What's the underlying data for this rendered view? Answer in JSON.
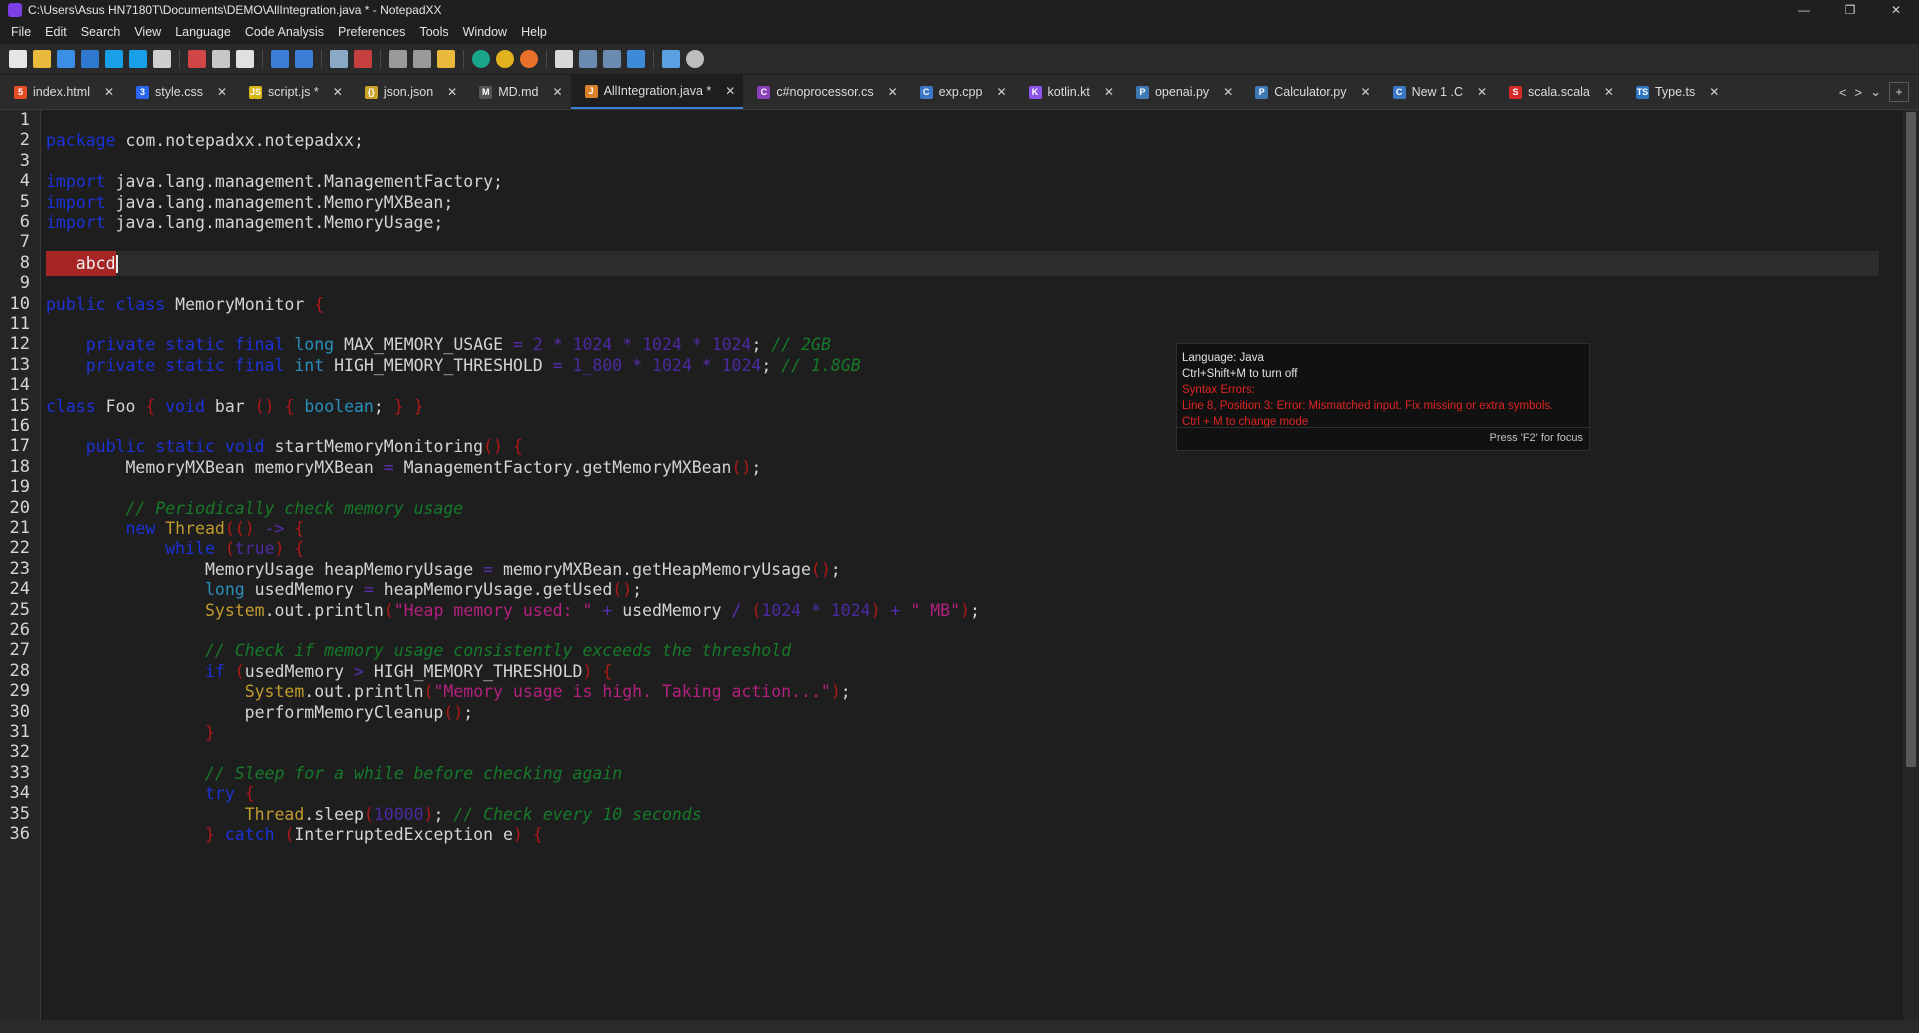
{
  "window": {
    "title": "C:\\Users\\Asus HN7180T\\Documents\\DEMO\\AllIntegration.java * - NotepadXX",
    "controls": {
      "minimize": "—",
      "restore": "❐",
      "close": "✕"
    }
  },
  "menu": [
    "File",
    "Edit",
    "Search",
    "View",
    "Language",
    "Code Analysis",
    "Preferences",
    "Tools",
    "Window",
    "Help"
  ],
  "tabs": [
    {
      "label": "index.html",
      "icon": "html-icon",
      "color": "#e44d26",
      "glyph": "5",
      "close": "✕"
    },
    {
      "label": "style.css",
      "icon": "css-icon",
      "color": "#2965f1",
      "glyph": "3",
      "close": "✕"
    },
    {
      "label": "script.js *",
      "icon": "js-icon",
      "color": "#d6b514",
      "glyph": "JS",
      "close": "✕"
    },
    {
      "label": "json.json",
      "icon": "json-icon",
      "color": "#c9a227",
      "glyph": "{}",
      "close": "✕"
    },
    {
      "label": "MD.md",
      "icon": "markdown-icon",
      "color": "#555555",
      "glyph": "M",
      "close": "✕"
    },
    {
      "label": "AllIntegration.java *",
      "icon": "java-icon",
      "color": "#d9822b",
      "glyph": "J",
      "close": "✕",
      "active": true
    },
    {
      "label": "c#noprocessor.cs",
      "icon": "csharp-icon",
      "color": "#8b3fb8",
      "glyph": "C",
      "close": "✕"
    },
    {
      "label": "exp.cpp",
      "icon": "cpp-icon",
      "color": "#3b77c4",
      "glyph": "C",
      "close": "✕"
    },
    {
      "label": "kotlin.kt",
      "icon": "kotlin-icon",
      "color": "#8c54e8",
      "glyph": "K",
      "close": "✕"
    },
    {
      "label": "openai.py",
      "icon": "python-icon",
      "color": "#3e79b4",
      "glyph": "P",
      "close": "✕"
    },
    {
      "label": "Calculator.py",
      "icon": "python-icon",
      "color": "#3e79b4",
      "glyph": "P",
      "close": "✕"
    },
    {
      "label": "New 1 .C",
      "icon": "c-icon",
      "color": "#3b77c4",
      "glyph": "C",
      "close": "✕"
    },
    {
      "label": "scala.scala",
      "icon": "scala-icon",
      "color": "#d42a2a",
      "glyph": "S",
      "close": "✕"
    },
    {
      "label": "Type.ts",
      "icon": "typescript-icon",
      "color": "#2f74c0",
      "glyph": "TS",
      "close": "✕"
    }
  ],
  "tab_nav": {
    "prev": "<",
    "next": ">",
    "dropdown": "⌄",
    "add": "+"
  },
  "popup": {
    "language": "Language: Java",
    "toggle_hint": "Ctrl+Shift+M to turn off",
    "syntax_header": "Syntax Errors:",
    "error": "Line 8, Position 3: Error: Mismatched input. Fix missing or extra symbols.",
    "mode_hint": "Ctrl + M to change mode",
    "footer": "Press 'F2' for focus"
  },
  "colors": {
    "error": "#e02424",
    "accent": "#3c7fd6",
    "keyword": "#1c32d8"
  },
  "code_lines": [
    {
      "n": "1",
      "tokens": []
    },
    {
      "n": "2",
      "tokens": [
        [
          "kw",
          "package"
        ],
        [
          "plain",
          " com.notepadxx.notepadxx;"
        ]
      ]
    },
    {
      "n": "3",
      "tokens": []
    },
    {
      "n": "4",
      "tokens": [
        [
          "kw",
          "import"
        ],
        [
          "plain",
          " java.lang.management.ManagementFactory;"
        ]
      ]
    },
    {
      "n": "5",
      "tokens": [
        [
          "kw",
          "import"
        ],
        [
          "plain",
          " java.lang.management.MemoryMXBean;"
        ]
      ]
    },
    {
      "n": "6",
      "tokens": [
        [
          "kw",
          "import"
        ],
        [
          "plain",
          " java.lang.management.MemoryUsage;"
        ]
      ]
    },
    {
      "n": "7",
      "tokens": []
    },
    {
      "n": "8",
      "tokens": [
        [
          "err",
          "   abcd"
        ]
      ],
      "current": true
    },
    {
      "n": "9",
      "tokens": []
    },
    {
      "n": "10",
      "tokens": [
        [
          "kw",
          "public class"
        ],
        [
          "plain",
          " MemoryMonitor "
        ],
        [
          "pn",
          "{"
        ]
      ]
    },
    {
      "n": "11",
      "tokens": []
    },
    {
      "n": "12",
      "tokens": [
        [
          "plain",
          "    "
        ],
        [
          "kw",
          "private static final"
        ],
        [
          "plain",
          " "
        ],
        [
          "ty",
          "long"
        ],
        [
          "plain",
          " MAX_MEMORY_USAGE "
        ],
        [
          "op",
          "="
        ],
        [
          "plain",
          " "
        ],
        [
          "nm",
          "2"
        ],
        [
          "plain",
          " "
        ],
        [
          "op",
          "*"
        ],
        [
          "plain",
          " "
        ],
        [
          "nm",
          "1024"
        ],
        [
          "plain",
          " "
        ],
        [
          "op",
          "*"
        ],
        [
          "plain",
          " "
        ],
        [
          "nm",
          "1024"
        ],
        [
          "plain",
          " "
        ],
        [
          "op",
          "*"
        ],
        [
          "plain",
          " "
        ],
        [
          "nm",
          "1024"
        ],
        [
          "plain",
          "; "
        ],
        [
          "cm",
          "// 2GB"
        ]
      ]
    },
    {
      "n": "13",
      "tokens": [
        [
          "plain",
          "    "
        ],
        [
          "kw",
          "private static final"
        ],
        [
          "plain",
          " "
        ],
        [
          "ty",
          "int"
        ],
        [
          "plain",
          " HIGH_MEMORY_THRESHOLD "
        ],
        [
          "op",
          "="
        ],
        [
          "plain",
          " "
        ],
        [
          "nm",
          "1_800"
        ],
        [
          "plain",
          " "
        ],
        [
          "op",
          "*"
        ],
        [
          "plain",
          " "
        ],
        [
          "nm",
          "1024"
        ],
        [
          "plain",
          " "
        ],
        [
          "op",
          "*"
        ],
        [
          "plain",
          " "
        ],
        [
          "nm",
          "1024"
        ],
        [
          "plain",
          "; "
        ],
        [
          "cm",
          "// 1.8GB"
        ]
      ]
    },
    {
      "n": "14",
      "tokens": []
    },
    {
      "n": "15",
      "tokens": [
        [
          "kw",
          "class"
        ],
        [
          "plain",
          " Foo "
        ],
        [
          "pn",
          "{"
        ],
        [
          "plain",
          " "
        ],
        [
          "kw",
          "void"
        ],
        [
          "plain",
          " bar "
        ],
        [
          "pn",
          "()"
        ],
        [
          "plain",
          " "
        ],
        [
          "pn",
          "{"
        ],
        [
          "plain",
          " "
        ],
        [
          "ty",
          "boolean"
        ],
        [
          "plain",
          "; "
        ],
        [
          "pn",
          "}"
        ],
        [
          "plain",
          " "
        ],
        [
          "pn",
          "}"
        ]
      ]
    },
    {
      "n": "16",
      "tokens": []
    },
    {
      "n": "17",
      "tokens": [
        [
          "plain",
          "    "
        ],
        [
          "kw",
          "public static void"
        ],
        [
          "plain",
          " startMemoryMonitoring"
        ],
        [
          "pn",
          "()"
        ],
        [
          "plain",
          " "
        ],
        [
          "pn",
          "{"
        ]
      ]
    },
    {
      "n": "18",
      "tokens": [
        [
          "plain",
          "        MemoryMXBean memoryMXBean "
        ],
        [
          "op",
          "="
        ],
        [
          "plain",
          " ManagementFactory.getMemoryMXBean"
        ],
        [
          "pn",
          "()"
        ],
        [
          "plain",
          ";"
        ]
      ]
    },
    {
      "n": "19",
      "tokens": []
    },
    {
      "n": "20",
      "tokens": [
        [
          "plain",
          "        "
        ],
        [
          "cm",
          "// Periodically check memory usage"
        ]
      ]
    },
    {
      "n": "21",
      "tokens": [
        [
          "plain",
          "        "
        ],
        [
          "kw",
          "new"
        ],
        [
          "plain",
          " "
        ],
        [
          "cls",
          "Thread"
        ],
        [
          "pn",
          "(()"
        ],
        [
          "plain",
          " "
        ],
        [
          "op",
          "->"
        ],
        [
          "plain",
          " "
        ],
        [
          "pn",
          "{"
        ]
      ]
    },
    {
      "n": "22",
      "tokens": [
        [
          "plain",
          "            "
        ],
        [
          "kw",
          "while"
        ],
        [
          "plain",
          " "
        ],
        [
          "pn",
          "("
        ],
        [
          "nm",
          "true"
        ],
        [
          "pn",
          ")"
        ],
        [
          "plain",
          " "
        ],
        [
          "pn",
          "{"
        ]
      ]
    },
    {
      "n": "23",
      "tokens": [
        [
          "plain",
          "                MemoryUsage heapMemoryUsage "
        ],
        [
          "op",
          "="
        ],
        [
          "plain",
          " memoryMXBean.getHeapMemoryUsage"
        ],
        [
          "pn",
          "()"
        ],
        [
          "plain",
          ";"
        ]
      ]
    },
    {
      "n": "24",
      "tokens": [
        [
          "plain",
          "                "
        ],
        [
          "ty",
          "long"
        ],
        [
          "plain",
          " usedMemory "
        ],
        [
          "op",
          "="
        ],
        [
          "plain",
          " heapMemoryUsage.getUsed"
        ],
        [
          "pn",
          "()"
        ],
        [
          "plain",
          ";"
        ]
      ]
    },
    {
      "n": "25",
      "tokens": [
        [
          "plain",
          "                "
        ],
        [
          "cls",
          "System"
        ],
        [
          "plain",
          ".out.println"
        ],
        [
          "pn",
          "("
        ],
        [
          "st",
          "\"Heap memory used: \""
        ],
        [
          "plain",
          " "
        ],
        [
          "op",
          "+"
        ],
        [
          "plain",
          " usedMemory "
        ],
        [
          "op",
          "/"
        ],
        [
          "plain",
          " "
        ],
        [
          "pn",
          "("
        ],
        [
          "nm",
          "1024"
        ],
        [
          "plain",
          " "
        ],
        [
          "op",
          "*"
        ],
        [
          "plain",
          " "
        ],
        [
          "nm",
          "1024"
        ],
        [
          "pn",
          ")"
        ],
        [
          "plain",
          " "
        ],
        [
          "op",
          "+"
        ],
        [
          "plain",
          " "
        ],
        [
          "st",
          "\" MB\""
        ],
        [
          "pn",
          ")"
        ],
        [
          "plain",
          ";"
        ]
      ]
    },
    {
      "n": "26",
      "tokens": []
    },
    {
      "n": "27",
      "tokens": [
        [
          "plain",
          "                "
        ],
        [
          "cm",
          "// Check if memory usage consistently exceeds the threshold"
        ]
      ]
    },
    {
      "n": "28",
      "tokens": [
        [
          "plain",
          "                "
        ],
        [
          "kw",
          "if"
        ],
        [
          "plain",
          " "
        ],
        [
          "pn",
          "("
        ],
        [
          "plain",
          "usedMemory "
        ],
        [
          "op",
          ">"
        ],
        [
          "plain",
          " HIGH_MEMORY_THRESHOLD"
        ],
        [
          "pn",
          ")"
        ],
        [
          "plain",
          " "
        ],
        [
          "pn",
          "{"
        ]
      ]
    },
    {
      "n": "29",
      "tokens": [
        [
          "plain",
          "                    "
        ],
        [
          "cls",
          "System"
        ],
        [
          "plain",
          ".out.println"
        ],
        [
          "pn",
          "("
        ],
        [
          "st",
          "\"Memory usage is high. Taking action...\""
        ],
        [
          "pn",
          ")"
        ],
        [
          "plain",
          ";"
        ]
      ]
    },
    {
      "n": "30",
      "tokens": [
        [
          "plain",
          "                    performMemoryCleanup"
        ],
        [
          "pn",
          "()"
        ],
        [
          "plain",
          ";"
        ]
      ]
    },
    {
      "n": "31",
      "tokens": [
        [
          "plain",
          "                "
        ],
        [
          "pn",
          "}"
        ]
      ]
    },
    {
      "n": "32",
      "tokens": []
    },
    {
      "n": "33",
      "tokens": [
        [
          "plain",
          "                "
        ],
        [
          "cm",
          "// Sleep for a while before checking again"
        ]
      ]
    },
    {
      "n": "34",
      "tokens": [
        [
          "plain",
          "                "
        ],
        [
          "kw",
          "try"
        ],
        [
          "plain",
          " "
        ],
        [
          "pn",
          "{"
        ]
      ]
    },
    {
      "n": "35",
      "tokens": [
        [
          "plain",
          "                    "
        ],
        [
          "cls",
          "Thread"
        ],
        [
          "plain",
          ".sleep"
        ],
        [
          "pn",
          "("
        ],
        [
          "nm",
          "10000"
        ],
        [
          "pn",
          ")"
        ],
        [
          "plain",
          "; "
        ],
        [
          "cm",
          "// Check every 10 seconds"
        ]
      ]
    },
    {
      "n": "36",
      "tokens": [
        [
          "plain",
          "                "
        ],
        [
          "pn",
          "}"
        ],
        [
          "plain",
          " "
        ],
        [
          "kw",
          "catch"
        ],
        [
          "plain",
          " "
        ],
        [
          "pn",
          "("
        ],
        [
          "plain",
          "InterruptedException e"
        ],
        [
          "pn",
          ")"
        ],
        [
          "plain",
          " "
        ],
        [
          "pn",
          "{"
        ]
      ]
    }
  ]
}
